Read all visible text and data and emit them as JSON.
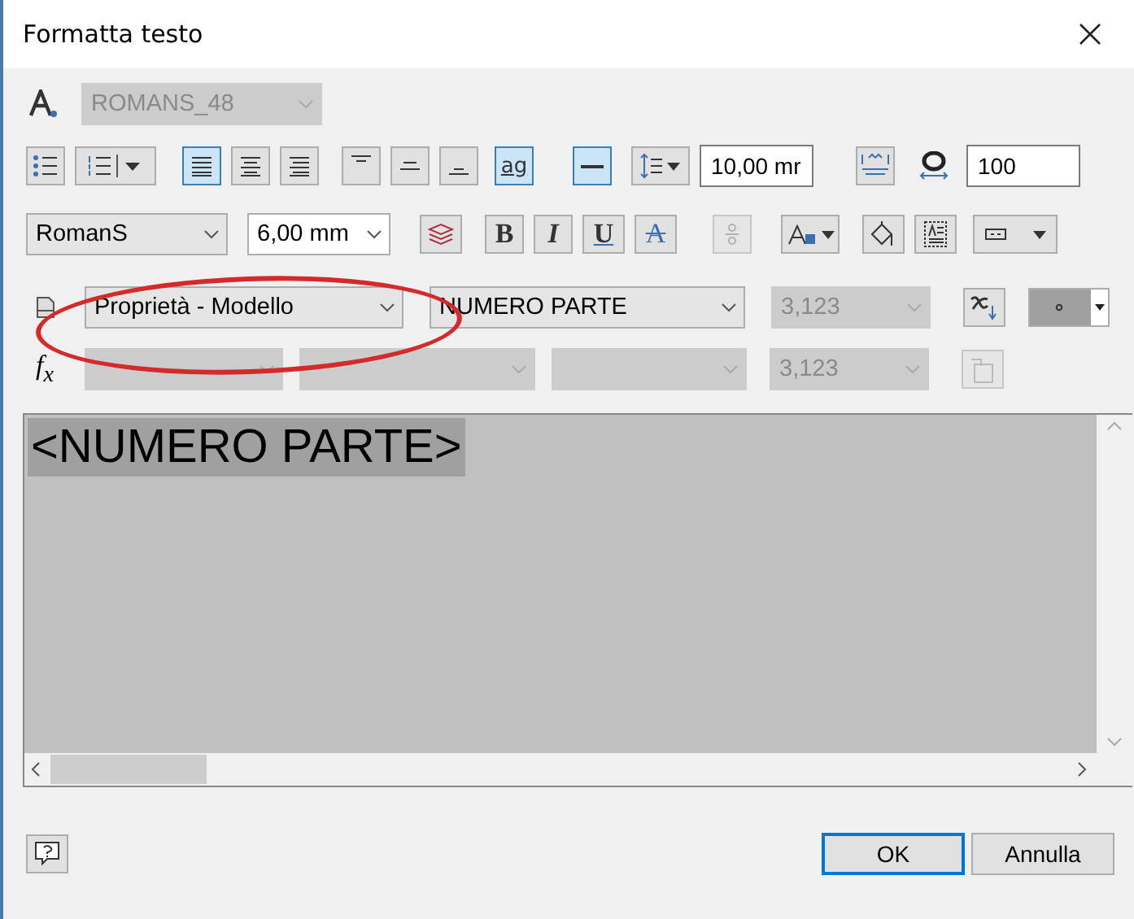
{
  "window": {
    "title": "Formatta testo"
  },
  "text_style": {
    "value": "ROMANS_48",
    "disabled": true
  },
  "paragraph_buttons": [
    {
      "kind": "bullets",
      "selected": false
    },
    {
      "kind": "numbering",
      "selected": false
    },
    {
      "kind": "align-left",
      "selected": true
    },
    {
      "kind": "align-center",
      "selected": false
    },
    {
      "kind": "align-right",
      "selected": false
    },
    {
      "kind": "valign-top",
      "selected": false
    },
    {
      "kind": "valign-middle",
      "selected": false
    },
    {
      "kind": "valign-bottom",
      "selected": false
    },
    {
      "kind": "text",
      "label": "ag",
      "selected": true
    },
    {
      "kind": "line",
      "selected": true
    },
    {
      "kind": "spacing",
      "selected": false
    }
  ],
  "line_spacing": {
    "value": "10,00 mr"
  },
  "width_factor": {
    "value": "100"
  },
  "font": {
    "value": "RomanS"
  },
  "size": {
    "value": "6,00 mm"
  },
  "format_buttons": [
    {
      "kind": "layers",
      "disabled": false
    },
    {
      "kind": "bold",
      "label": "B",
      "disabled": false
    },
    {
      "kind": "italic",
      "label": "I",
      "disabled": false
    },
    {
      "kind": "underline",
      "label": "U",
      "disabled": false
    },
    {
      "kind": "strike",
      "label": "A",
      "disabled": false
    },
    {
      "kind": "fraction",
      "disabled": true
    },
    {
      "kind": "case",
      "disabled": false
    },
    {
      "kind": "fill",
      "disabled": false
    },
    {
      "kind": "frame",
      "disabled": false
    },
    {
      "kind": "symbol",
      "disabled": false
    }
  ],
  "parameter_row": {
    "type": "Proprietà - Modello",
    "property": "NUMERO PARTE",
    "precision": "3,123",
    "precision_disabled": true
  },
  "function_row": {
    "label": "f$_{x}$",
    "precision": "3,123",
    "precision_disabled": true
  },
  "editor": {
    "text": "<NUMERO PARTE>",
    "highlighted": true
  },
  "buttons": [
    {
      "label": "OK",
      "default": true
    },
    {
      "label": "Annulla",
      "default": false
    }
  ]
}
